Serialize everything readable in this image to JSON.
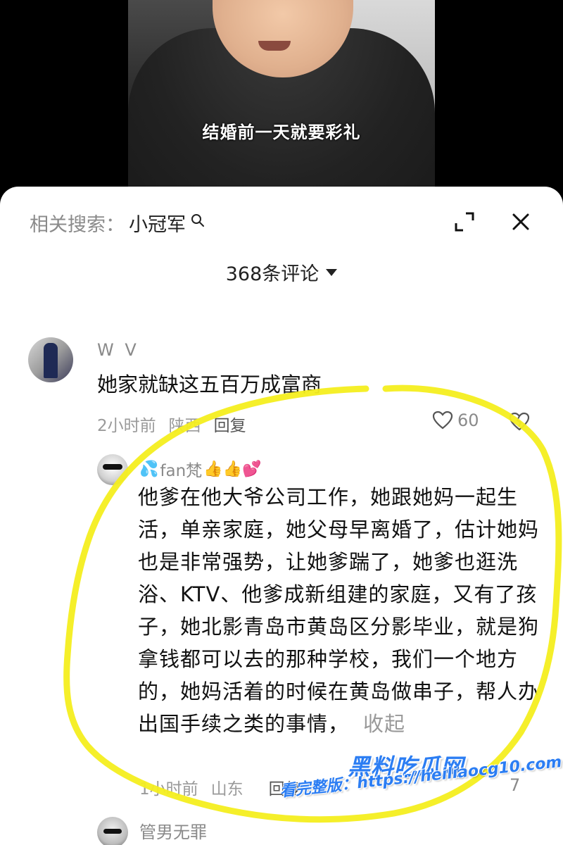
{
  "video": {
    "subtitle": "结婚前一天就要彩礼"
  },
  "sheet": {
    "related_label": "相关搜索：",
    "related_keyword": "小冠军",
    "comment_count": "368条评论",
    "icons": {
      "search": "search-icon",
      "expand": "expand-icon",
      "close": "close-icon",
      "dropdown": "caret-down-icon",
      "like": "heart-icon",
      "dislike": "broken-heart-icon"
    }
  },
  "comments": [
    {
      "user": "W V",
      "text": "她家就缺这五百万成富商",
      "time": "2小时前",
      "location": "陕西",
      "reply": "回复",
      "likes": "60"
    },
    {
      "user": "fan梵",
      "prefix_emoji": "💦",
      "suffix_emoji": "👍👍💕",
      "text": "他爹在他大爷公司工作，她跟她妈一起生活，单亲家庭，她父母早离婚了，估计她妈也是非常强势，让她爹踹了，她爹也逛洗浴、KTV、他爹成新组建的家庭，又有了孩子，她北影青岛市黄岛区分影毕业，就是狗拿钱都可以去的那种学校，我们一个地方的，她妈活着的时候在黄岛做串子，帮人办出国手续之类的事情，",
      "collapse": "收起",
      "time": "1小时前",
      "location": "山东",
      "reply": "回复",
      "likes": "7"
    },
    {
      "user": "管男无罪"
    }
  ],
  "watermark": {
    "brand": "黑料吃瓜网",
    "url_line": "看完整版：https://heiliaocg10.com"
  },
  "colors": {
    "highlight": "#f4ee1f",
    "watermark": "#2b7df3"
  }
}
